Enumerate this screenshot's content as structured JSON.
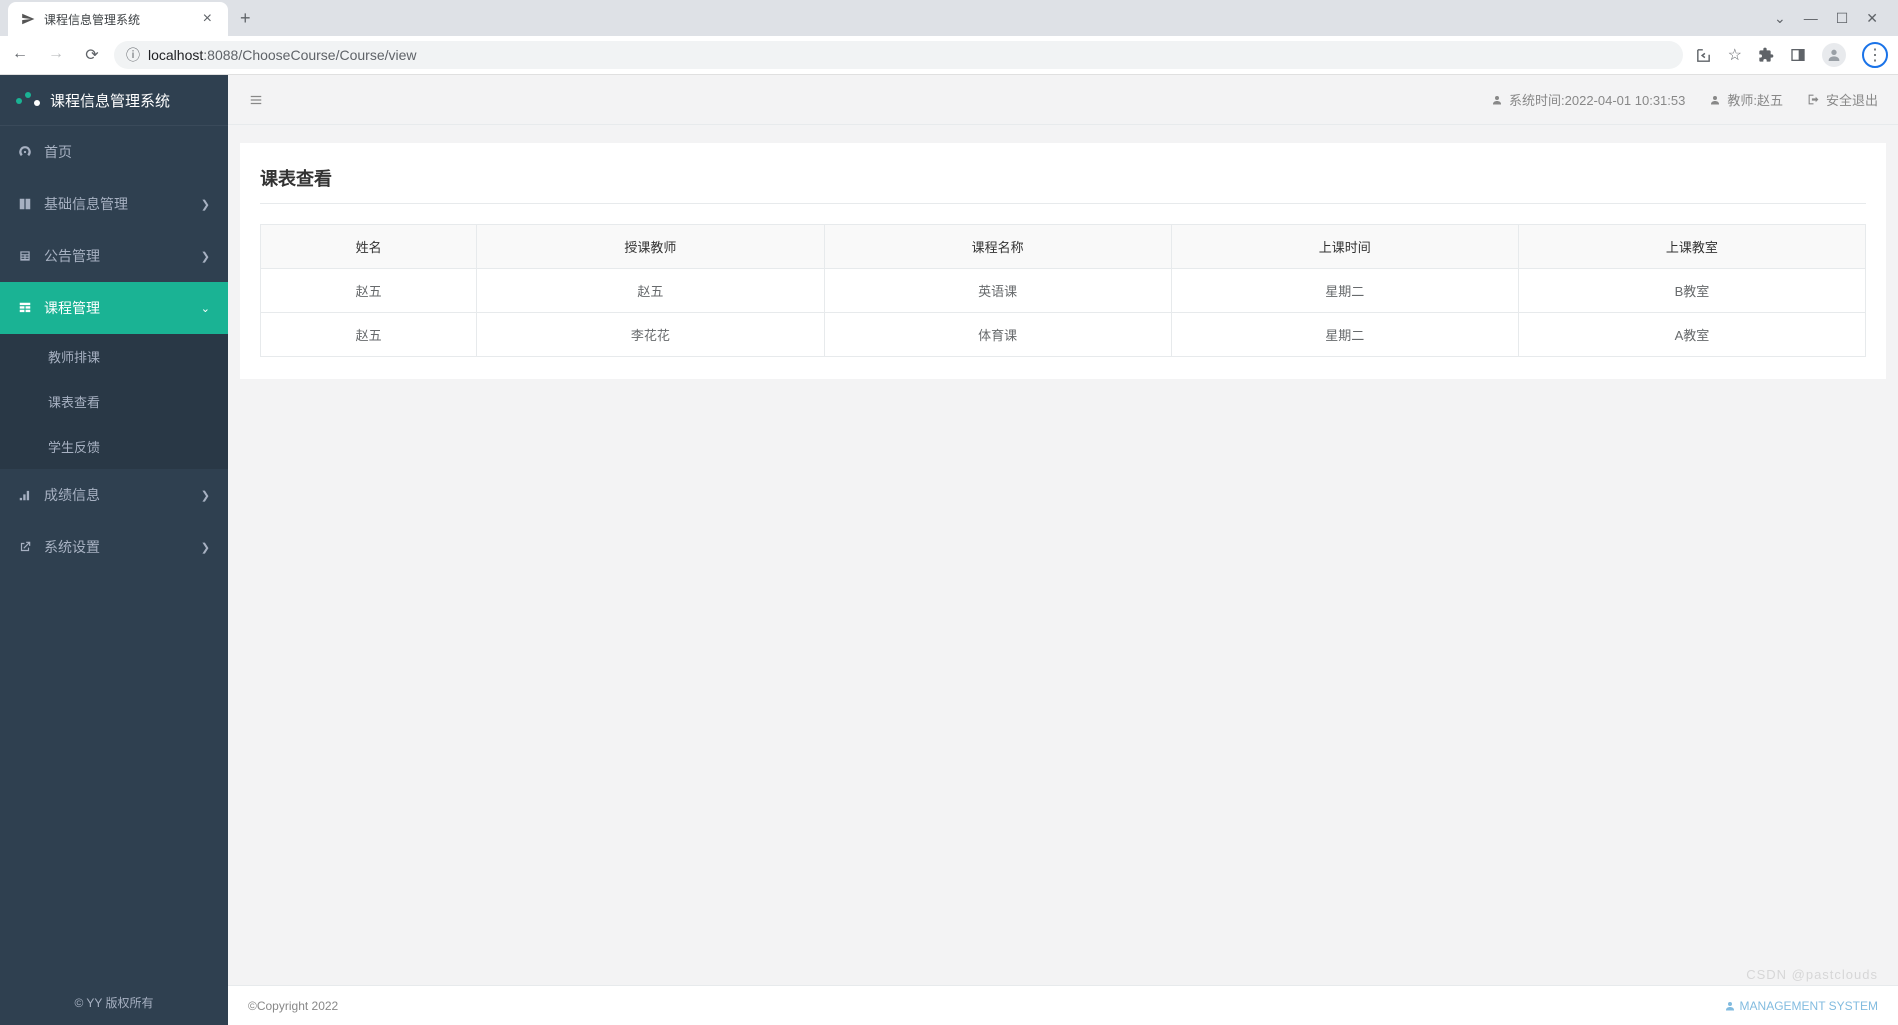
{
  "browser": {
    "tab_title": "课程信息管理系统",
    "url_host": "localhost",
    "url_port": ":8088",
    "url_path": "/ChooseCourse/Course/view"
  },
  "app": {
    "logo_text": "课程信息管理系统",
    "sidebar_footer": "© YY 版权所有"
  },
  "sidebar": {
    "items": [
      {
        "label": "首页"
      },
      {
        "label": "基础信息管理"
      },
      {
        "label": "公告管理"
      },
      {
        "label": "课程管理"
      },
      {
        "label": "成绩信息"
      },
      {
        "label": "系统设置"
      }
    ],
    "submenu_course": [
      {
        "label": "教师排课"
      },
      {
        "label": "课表查看"
      },
      {
        "label": "学生反馈"
      }
    ]
  },
  "topbar": {
    "system_time_prefix": "系统时间:",
    "system_time": "2022-04-01 10:31:53",
    "role_label": "教师:赵五",
    "logout": "安全退出"
  },
  "page": {
    "title": "课表查看"
  },
  "table": {
    "headers": [
      "姓名",
      "授课教师",
      "课程名称",
      "上课时间",
      "上课教室"
    ],
    "rows": [
      [
        "赵五",
        "赵五",
        "英语课",
        "星期二",
        "B教室"
      ],
      [
        "赵五",
        "李花花",
        "体育课",
        "星期二",
        "A教室"
      ]
    ]
  },
  "footer": {
    "left": "©Copyright 2022",
    "right": "MANAGEMENT SYSTEM",
    "watermark": "CSDN @pastclouds"
  }
}
